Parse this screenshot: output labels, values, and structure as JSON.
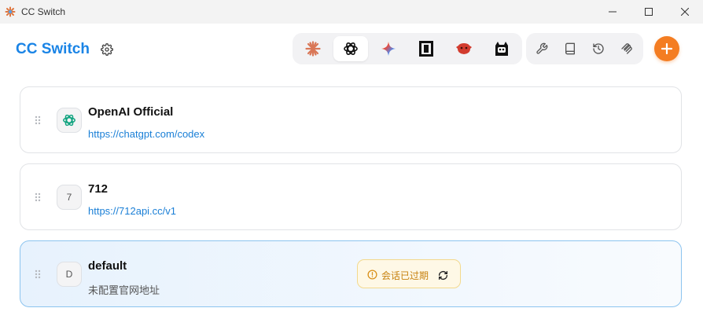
{
  "window": {
    "title": "CC Switch"
  },
  "header": {
    "brand": "CC Switch"
  },
  "apps": [
    {
      "icon": "claude-icon",
      "active": false
    },
    {
      "icon": "openai-icon",
      "active": true
    },
    {
      "icon": "gemini-icon",
      "active": false
    },
    {
      "icon": "opencode-icon",
      "active": false
    },
    {
      "icon": "red-mascot-icon",
      "active": false
    },
    {
      "icon": "cat-mascot-icon",
      "active": false
    }
  ],
  "tools": [
    "wrench-icon",
    "book-icon",
    "history-icon",
    "plug-icon"
  ],
  "providers": [
    {
      "avatar": "",
      "avatar_icon": "openai-icon",
      "name": "OpenAI Official",
      "url": "https://chatgpt.com/codex"
    },
    {
      "avatar": "7",
      "name": "712",
      "url": "https://712api.cc/v1"
    },
    {
      "avatar": "D",
      "name": "default",
      "url": "未配置官网地址",
      "selected": true,
      "badge": "会话已过期"
    }
  ],
  "colors": {
    "brand": "#1a84e6",
    "accent": "#f47d22",
    "link": "#1a7fd6",
    "warning": "#c7810e"
  }
}
